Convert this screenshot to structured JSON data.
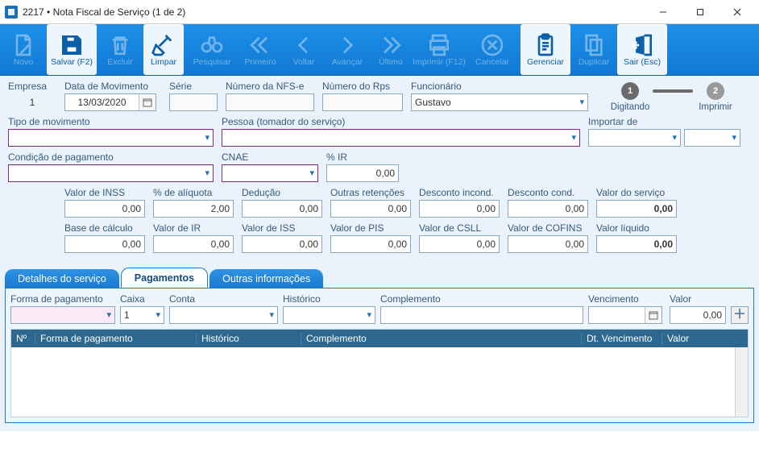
{
  "window": {
    "title": "2217 • Nota Fiscal de Serviço (1 de 2)"
  },
  "toolbar": {
    "novo": "Novo",
    "salvar": "Salvar (F2)",
    "excluir": "Excluir",
    "limpar": "Limpar",
    "pesquisar": "Pesquisar",
    "primeiro": "Primeiro",
    "voltar": "Voltar",
    "avancar": "Avançar",
    "ultimo": "Último",
    "imprimir": "Imprimir (F12)",
    "cancelar": "Cancelar",
    "gerenciar": "Gerenciar",
    "duplicar": "Duplicar",
    "sair": "Sair (Esc)"
  },
  "stepper": {
    "step1_num": "1",
    "step1_label": "Digitando",
    "step2_num": "2",
    "step2_label": "Imprimir"
  },
  "labels": {
    "empresa": "Empresa",
    "data_movimento": "Data de Movimento",
    "serie": "Série",
    "numero_nfse": "Número da NFS-e",
    "numero_rps": "Número do Rps",
    "funcionario": "Funcionário",
    "tipo_movimento": "Tipo de movimento",
    "pessoa": "Pessoa (tomador do serviço)",
    "importar_de": "Importar de",
    "cond_pag": "Condição de pagamento",
    "cnae": "CNAE",
    "pct_ir": "% IR",
    "valor_inss": "Valor de INSS",
    "pct_aliquota": "% de alíquota",
    "deducao": "Dedução",
    "outras_ret": "Outras retenções",
    "desc_incond": "Desconto incond.",
    "desc_cond": "Desconto cond.",
    "valor_servico": "Valor do serviço",
    "base_calculo": "Base de cálculo",
    "valor_ir": "Valor de IR",
    "valor_iss": "Valor de ISS",
    "valor_pis": "Valor de PIS",
    "valor_csll": "Valor de CSLL",
    "valor_cofins": "Valor de COFINS",
    "valor_liquido": "Valor líquido"
  },
  "values": {
    "empresa": "1",
    "data_movimento": "13/03/2020",
    "serie": "",
    "numero_nfse": "",
    "numero_rps": "",
    "funcionario": "Gustavo",
    "tipo_movimento": "",
    "pessoa": "",
    "importar_de_1": "",
    "importar_de_2": "",
    "cond_pag": "",
    "cnae": "",
    "pct_ir": "0,00",
    "valor_inss": "0,00",
    "pct_aliquota": "2,00",
    "deducao": "0,00",
    "outras_ret": "0,00",
    "desc_incond": "0,00",
    "desc_cond": "0,00",
    "valor_servico": "0,00",
    "base_calculo": "0,00",
    "valor_ir": "0,00",
    "valor_iss": "0,00",
    "valor_pis": "0,00",
    "valor_csll": "0,00",
    "valor_cofins": "0,00",
    "valor_liquido": "0,00"
  },
  "tabs": {
    "detalhes": "Detalhes do serviço",
    "pagamentos": "Pagamentos",
    "outras": "Outras informações"
  },
  "payments": {
    "labels": {
      "forma": "Forma de pagamento",
      "caixa": "Caixa",
      "conta": "Conta",
      "historico": "Histórico",
      "complemento": "Complemento",
      "vencimento": "Vencimento",
      "valor": "Valor"
    },
    "values": {
      "forma": "",
      "caixa": "1",
      "conta": "",
      "historico": "",
      "complemento": "",
      "vencimento": "",
      "valor": "0,00"
    },
    "grid": {
      "col_num": "Nº",
      "col_forma": "Forma de pagamento",
      "col_historico": "Histórico",
      "col_complemento": "Complemento",
      "col_venc": "Dt. Vencimento",
      "col_valor": "Valor"
    }
  }
}
